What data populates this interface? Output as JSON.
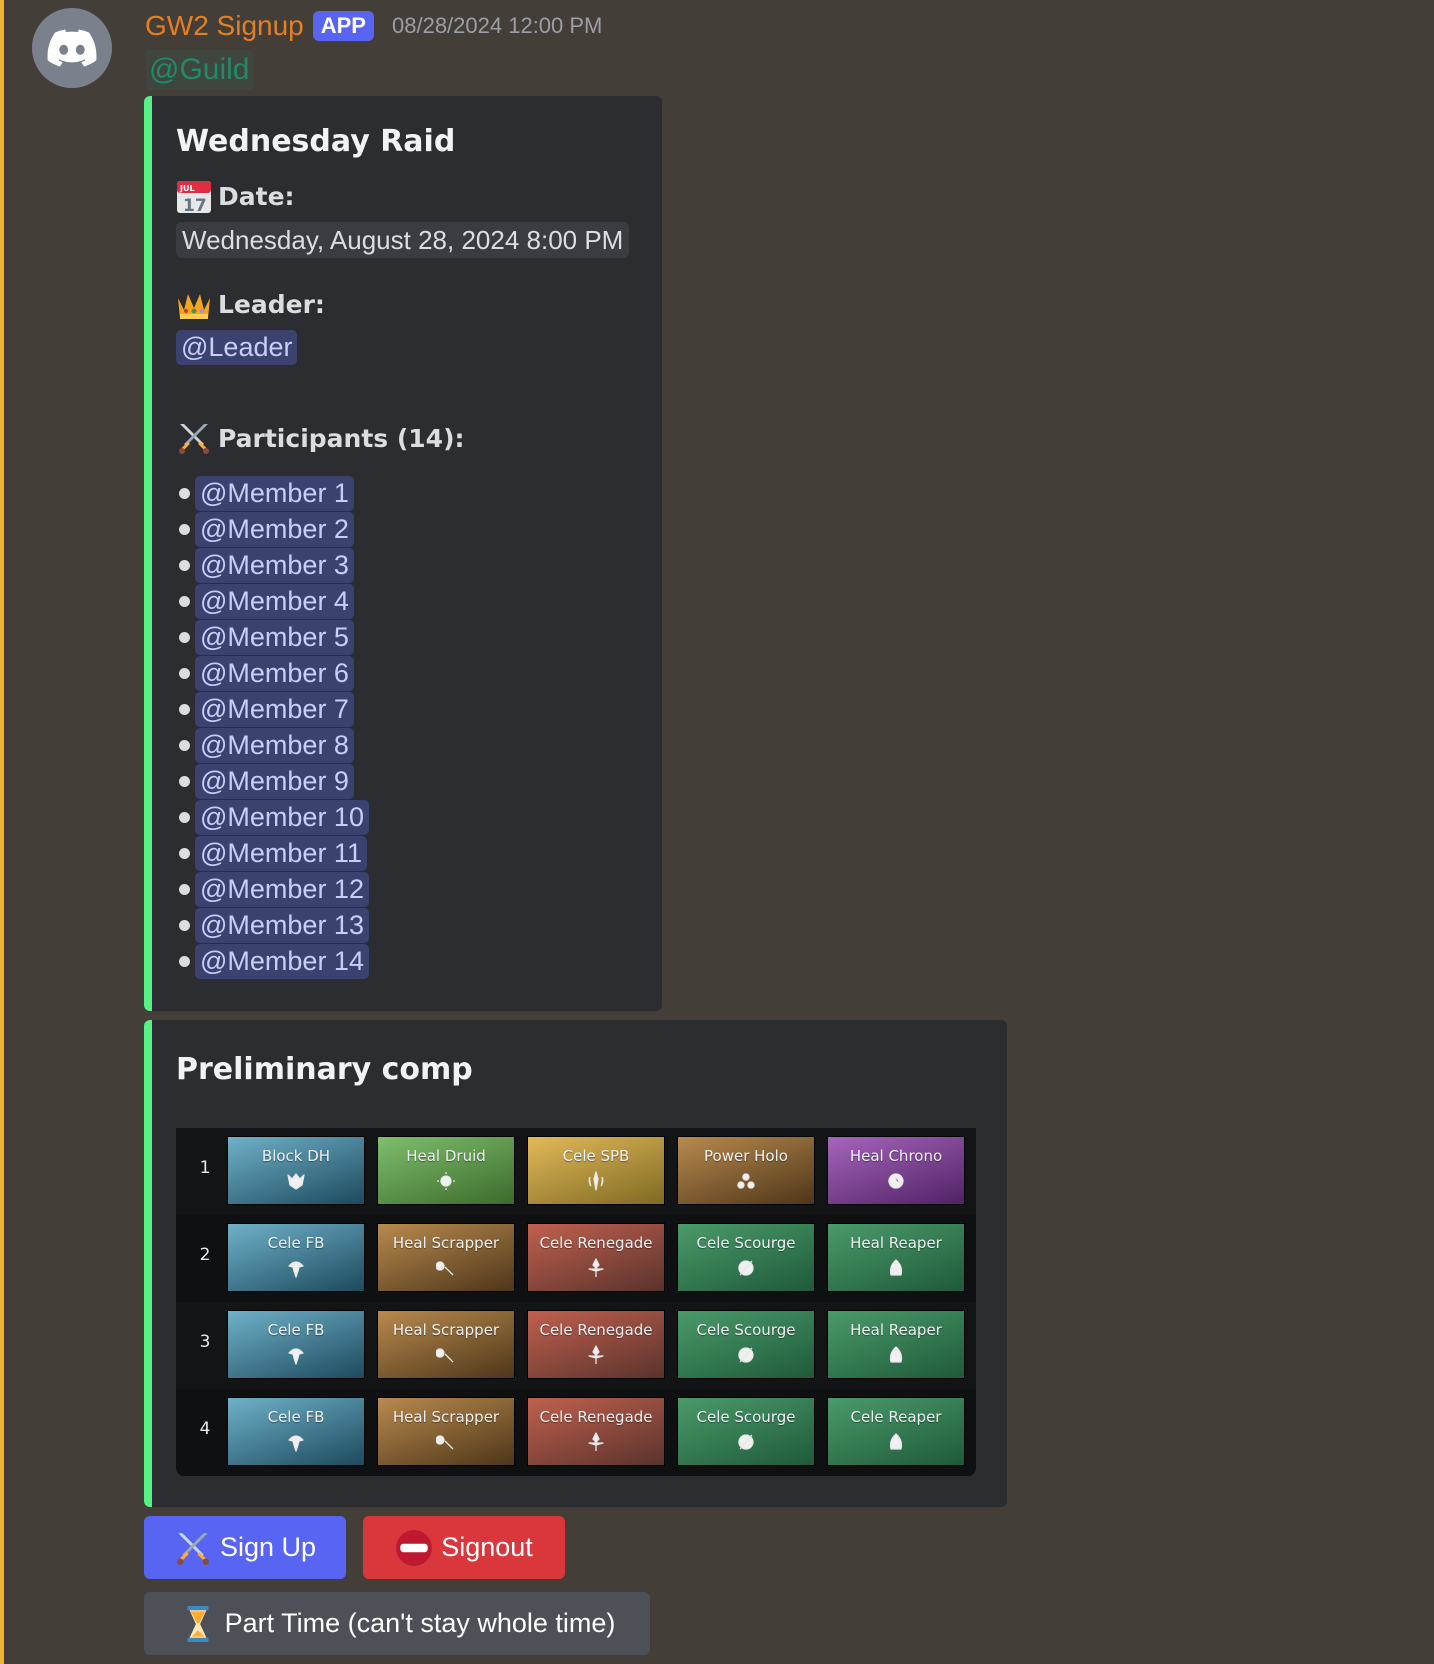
{
  "message": {
    "author": "GW2 Signup",
    "badge": "APP",
    "timestamp": "08/28/2024 12:00 PM",
    "mention": "@Guild",
    "avatar_icon": "discord-logo-icon"
  },
  "event_embed": {
    "title": "Wednesday Raid",
    "date_label": "Date:",
    "date_icon": "calendar-icon",
    "date_value": "Wednesday, August 28, 2024 8:00 PM",
    "leader_label": "Leader:",
    "leader_icon": "crown-icon",
    "leader_mention": "@Leader",
    "participants_label": "Participants (14):",
    "participants_icon": "crossed-swords-icon",
    "participants": [
      "@Member 1",
      "@Member 2",
      "@Member 3",
      "@Member 4",
      "@Member 5",
      "@Member 6",
      "@Member 7",
      "@Member 8",
      "@Member 9",
      "@Member 10",
      "@Member 11",
      "@Member 12",
      "@Member 13",
      "@Member 14"
    ],
    "accent_color": "#57f287"
  },
  "comp_embed": {
    "title": "Preliminary comp",
    "rows": [
      {
        "number": "1",
        "cells": [
          {
            "label": "Block DH",
            "profession": "guardian",
            "icon": "dragonhunter-icon"
          },
          {
            "label": "Heal Druid",
            "profession": "ranger",
            "icon": "druid-icon"
          },
          {
            "label": "Cele SPB",
            "profession": "warrior",
            "icon": "spellbreaker-icon"
          },
          {
            "label": "Power Holo",
            "profession": "engineer",
            "icon": "holosmith-icon"
          },
          {
            "label": "Heal Chrono",
            "profession": "mesmer",
            "icon": "chronomancer-icon"
          }
        ]
      },
      {
        "number": "2",
        "cells": [
          {
            "label": "Cele FB",
            "profession": "guardian",
            "icon": "firebrand-icon"
          },
          {
            "label": "Heal Scrapper",
            "profession": "engineer",
            "icon": "scrapper-icon"
          },
          {
            "label": "Cele Renegade",
            "profession": "revenant",
            "icon": "renegade-icon"
          },
          {
            "label": "Cele Scourge",
            "profession": "necromancer",
            "icon": "scourge-icon"
          },
          {
            "label": "Heal Reaper",
            "profession": "necromancer",
            "icon": "reaper-icon"
          }
        ]
      },
      {
        "number": "3",
        "cells": [
          {
            "label": "Cele FB",
            "profession": "guardian",
            "icon": "firebrand-icon"
          },
          {
            "label": "Heal Scrapper",
            "profession": "engineer",
            "icon": "scrapper-icon"
          },
          {
            "label": "Cele Renegade",
            "profession": "revenant",
            "icon": "renegade-icon"
          },
          {
            "label": "Cele Scourge",
            "profession": "necromancer",
            "icon": "scourge-icon"
          },
          {
            "label": "Heal Reaper",
            "profession": "necromancer",
            "icon": "reaper-icon"
          }
        ]
      },
      {
        "number": "4",
        "cells": [
          {
            "label": "Cele FB",
            "profession": "guardian",
            "icon": "firebrand-icon"
          },
          {
            "label": "Heal Scrapper",
            "profession": "engineer",
            "icon": "scrapper-icon"
          },
          {
            "label": "Cele Renegade",
            "profession": "revenant",
            "icon": "renegade-icon"
          },
          {
            "label": "Cele Scourge",
            "profession": "necromancer",
            "icon": "scourge-icon"
          },
          {
            "label": "Cele Reaper",
            "profession": "necromancer",
            "icon": "reaper-icon"
          }
        ]
      }
    ],
    "profession_colors": {
      "guardian": [
        "#6fb1c8",
        "#1d4a5e"
      ],
      "ranger": [
        "#7ebf6d",
        "#3d6a2c"
      ],
      "warrior": [
        "#e3b95a",
        "#7e6a22"
      ],
      "engineer": [
        "#b88a4e",
        "#4e3619"
      ],
      "mesmer": [
        "#a764bd",
        "#4f2364"
      ],
      "revenant": [
        "#c0604e",
        "#5a332c"
      ],
      "necromancer": [
        "#4a9a6a",
        "#1f5a3a"
      ]
    }
  },
  "buttons": {
    "signup": {
      "label": "Sign Up",
      "icon": "crossed-swords-icon",
      "color": "#5865f2"
    },
    "signout": {
      "label": "Signout",
      "icon": "no-entry-icon",
      "color": "#da373c"
    },
    "parttime": {
      "label": "Part Time (can't stay whole time)",
      "icon": "hourglass-icon",
      "color": "#4e5058"
    }
  }
}
